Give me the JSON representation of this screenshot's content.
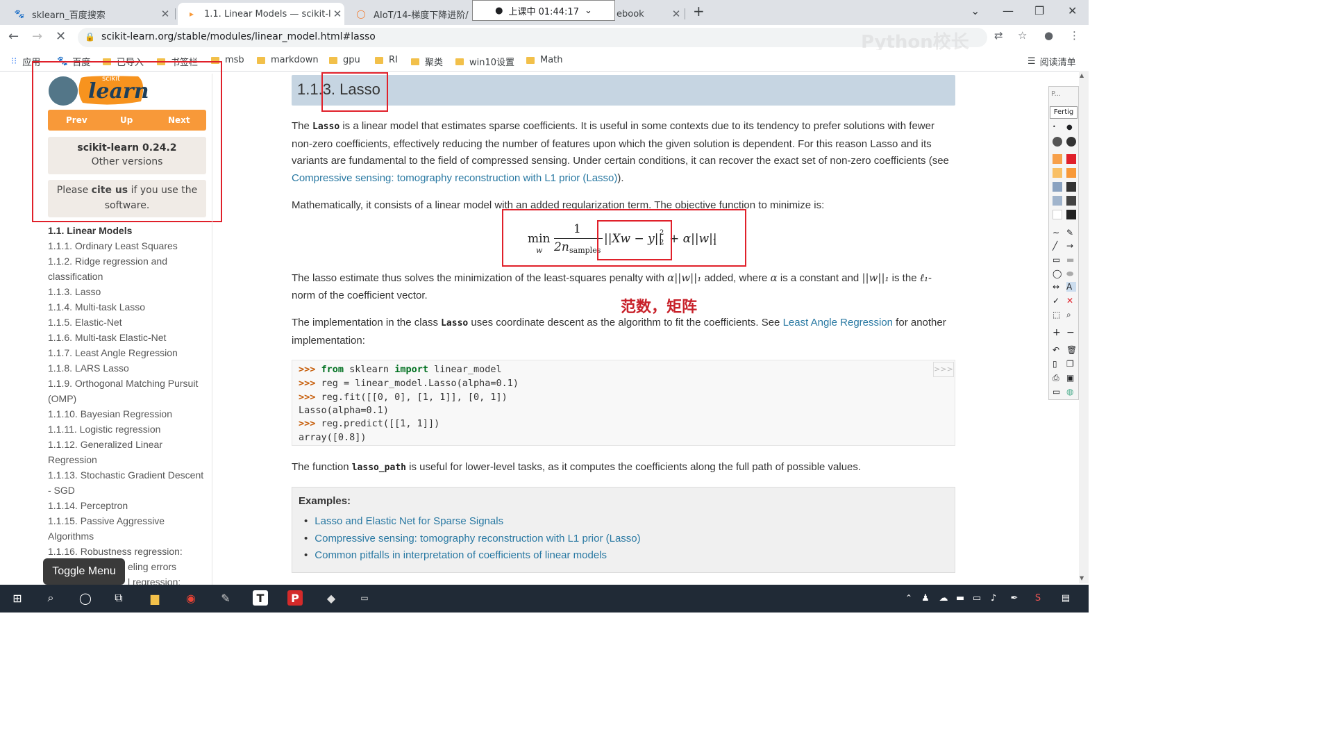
{
  "browser": {
    "tabs": [
      {
        "title": "sklearn_百度搜索",
        "icon": "baidu-paw-icon"
      },
      {
        "title": "1.1. Linear Models — scikit-le",
        "icon": "sklearn-icon"
      },
      {
        "title": "AIoT/14-梯度下降进阶/",
        "icon": "jupyter-icon"
      },
      {
        "title": "ebook",
        "icon": "none"
      }
    ],
    "timer": "上课中 01:44:17",
    "url": "scikit-learn.org/stable/modules/linear_model.html#lasso",
    "bookmarks": [
      "应用",
      "百度",
      "已导入",
      "书签栏",
      "msb",
      "markdown",
      "gpu",
      "RI",
      "聚类",
      "win10设置",
      "Math"
    ],
    "reading_list": "阅读清单",
    "watermark": "Python校长"
  },
  "sidebar": {
    "logo_small": "scikit",
    "logo_word": "learn",
    "nav": [
      "Prev",
      "Up",
      "Next"
    ],
    "version_title": "scikit-learn 0.24.2",
    "version_link": "Other versions",
    "cite_pre": "Please ",
    "cite_bold": "cite us",
    "cite_post": " if you use the software.",
    "toc": [
      "1.1. Linear Models",
      "1.1.1. Ordinary Least Squares",
      "1.1.2. Ridge regression and",
      "classification",
      "1.1.3. Lasso",
      "1.1.4. Multi-task Lasso",
      "1.1.5. Elastic-Net",
      "1.1.6. Multi-task Elastic-Net",
      "1.1.7. Least Angle Regression",
      "1.1.8. LARS Lasso",
      "1.1.9. Orthogonal Matching Pursuit",
      "(OMP)",
      "1.1.10. Bayesian Regression",
      "1.1.11. Logistic regression",
      "1.1.12. Generalized Linear",
      "Regression",
      "1.1.13. Stochastic Gradient Descent",
      "- SGD",
      "1.1.14. Perceptron",
      "1.1.15. Passive Aggressive",
      "Algorithms",
      "1.1.16. Robustness regression:",
      "eling errors",
      "l regression:"
    ],
    "toggle_menu": "Toggle Menu"
  },
  "main": {
    "heading": "1.1.3. Lasso",
    "p1_a": "The ",
    "p1_code": "Lasso",
    "p1_b": " is a linear model that estimates sparse coefficients. It is useful in some contexts due to its tendency to prefer solutions with fewer non-zero coefficients, effectively reducing the number of features upon which the given solution is dependent. For this reason Lasso and its variants are fundamental to the field of compressed sensing. Under certain conditions, it can recover the exact set of non-zero coefficients (see ",
    "p1_link": "Compressive sensing: tomography reconstruction with L1 prior (Lasso)",
    "p1_c": ").",
    "p2": "Mathematically, it consists of a linear model with an added regularization term. The objective function to minimize is:",
    "formula": {
      "min": "min",
      "sub": "w",
      "num": "1",
      "den": "2n",
      "den_sub": "samples",
      "norm": "||Xw − y||",
      "norm_sub": "2",
      "norm_sup": "2",
      "reg": "+ α||w||",
      "reg_sub": "1"
    },
    "p3_a": "The lasso estimate thus solves the minimization of the least-squares penalty with ",
    "p3_m1": "α||w||₁",
    "p3_b": " added, where ",
    "p3_m2": "α",
    "p3_c": " is a constant and ",
    "p3_m3": "||w||₁",
    "p3_d": " is the ",
    "p3_m4": "ℓ₁",
    "p3_e": "-norm of the coefficient vector.",
    "annotation": "范数，矩阵",
    "p4_a": "The implementation in the class ",
    "p4_code": "Lasso",
    "p4_b": " uses coordinate descent as the algorithm to fit the coefficients. See ",
    "p4_link": "Least Angle Regression",
    "p4_c": " for another implementation:",
    "code": [
      {
        "prompt": ">>> ",
        "kw": "from",
        "text1": " sklearn ",
        "kw2": "import",
        "text2": " linear_model"
      },
      {
        "prompt": ">>> ",
        "kw": "",
        "text1": "reg = linear_model.Lasso(alpha=0.1)",
        "kw2": "",
        "text2": ""
      },
      {
        "prompt": ">>> ",
        "kw": "",
        "text1": "reg.fit([[0, 0], [1, 1]], [0, 1])",
        "kw2": "",
        "text2": ""
      },
      {
        "prompt": "",
        "kw": "",
        "text1": "Lasso(alpha=0.1)",
        "kw2": "",
        "text2": ""
      },
      {
        "prompt": ">>> ",
        "kw": "",
        "text1": "reg.predict([[1, 1]])",
        "kw2": "",
        "text2": ""
      },
      {
        "prompt": "",
        "kw": "",
        "text1": "array([0.8])",
        "kw2": "",
        "text2": ""
      }
    ],
    "copy_button": ">>>",
    "p5_a": "The function ",
    "p5_code": "lasso_path",
    "p5_b": " is useful for lower-level tasks, as it computes the coefficients along the full path of possible values.",
    "examples_title": "Examples:",
    "examples": [
      "Lasso and Elastic Net for Sparse Signals",
      "Compressive sensing: tomography reconstruction with L1 prior (Lasso)",
      "Common pitfalls in interpretation of coefficients of linear models"
    ]
  },
  "toolpanel": {
    "top_label": "P...",
    "fertig": "Fertig"
  },
  "colors": {
    "accent": "#f89939",
    "heading_bg": "#c6d5e2",
    "link": "#2878a2",
    "annotation": "#e0202a"
  }
}
